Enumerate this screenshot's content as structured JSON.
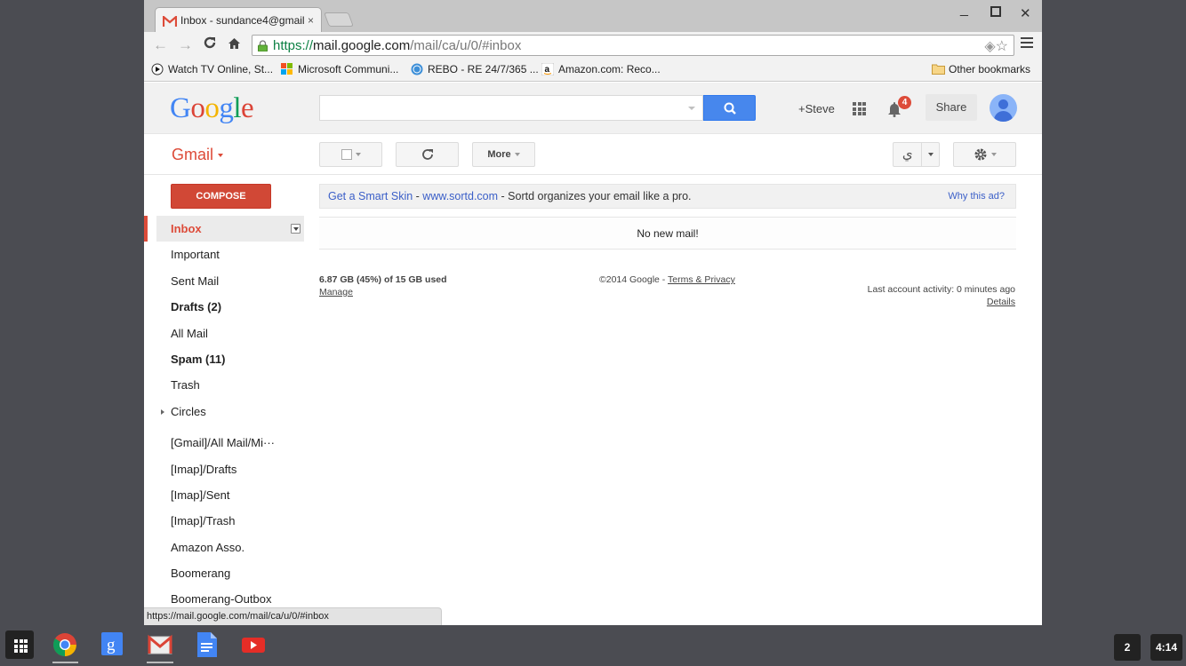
{
  "browser": {
    "tab_title": "Inbox - sundance4@gmail",
    "tab_close_icon": "×",
    "window_controls": {
      "minimize": "_",
      "maximize": "☐",
      "close": "✕"
    },
    "nav": {
      "back": "←",
      "forward": "→",
      "reload": "C",
      "home": "⌂"
    },
    "url": {
      "scheme": "https://",
      "host": "mail.google.com",
      "path": "/mail/ca/u/0/#inbox"
    },
    "omnibox_icons": [
      "extension-icon",
      "star-icon"
    ],
    "bookmarks": [
      {
        "label": "Watch TV Online, St...",
        "icon": "play-icon"
      },
      {
        "label": "Microsoft Communi...",
        "icon": "microsoft-icon"
      },
      {
        "label": "REBO - RE 24/7/365 ...",
        "icon": "rebo-icon"
      },
      {
        "label": "Amazon.com: Reco...",
        "icon": "amazon-icon"
      }
    ],
    "other_bookmarks": "Other bookmarks",
    "status_url": "https://mail.google.com/mail/ca/u/0/#inbox"
  },
  "header": {
    "logo": [
      "G",
      "o",
      "o",
      "g",
      "l",
      "e"
    ],
    "logo_colors": [
      "#4285f4",
      "#db4437",
      "#f4b400",
      "#4285f4",
      "#0f9d58",
      "#db4437"
    ],
    "search_value": "",
    "user_link": "+Steve",
    "notification_count": "4",
    "share_label": "Share"
  },
  "subheader": {
    "gmail_label": "Gmail",
    "more_label": "More",
    "input_tool_glyph": "ي"
  },
  "sidebar": {
    "compose_label": "COMPOSE",
    "items": [
      {
        "label": "Inbox",
        "active": true
      },
      {
        "label": "Important"
      },
      {
        "label": "Sent Mail"
      },
      {
        "label": "Drafts (2)",
        "bold": true
      },
      {
        "label": "All Mail"
      },
      {
        "label": "Spam (11)",
        "bold": true
      },
      {
        "label": "Trash"
      },
      {
        "label": "Circles",
        "expandable": true
      },
      {
        "label": "[Gmail]/All Mail/Mi···"
      },
      {
        "label": "[Imap]/Drafts"
      },
      {
        "label": "[Imap]/Sent"
      },
      {
        "label": "[Imap]/Trash"
      },
      {
        "label": "Amazon Asso."
      },
      {
        "label": "Boomerang"
      },
      {
        "label": "Boomerang-Outbox"
      }
    ]
  },
  "main": {
    "ad": {
      "title": "Get a Smart Skin",
      "sep1": " - ",
      "domain": "www.sortd.com",
      "sep2": " - ",
      "text": "Sortd organizes your email like a pro.",
      "why": "Why this ad?"
    },
    "empty_message": "No new mail!",
    "footer": {
      "storage": "6.87 GB (45%) of 15 GB used",
      "storage_percent": 45,
      "manage": "Manage",
      "copyright": "©2014 Google - ",
      "terms": "Terms & Privacy",
      "activity": "Last account activity: 0 minutes ago",
      "details": "Details"
    }
  },
  "shelf": {
    "apps": [
      "chrome-icon",
      "google-search-icon",
      "gmail-icon",
      "docs-icon",
      "youtube-icon"
    ],
    "notifications": "2",
    "time": "4:14"
  },
  "colors": {
    "gmail_red": "#dd4b39",
    "compose_red": "#d14836",
    "search_blue": "#4787ed",
    "link_blue": "#3b5fc8"
  }
}
